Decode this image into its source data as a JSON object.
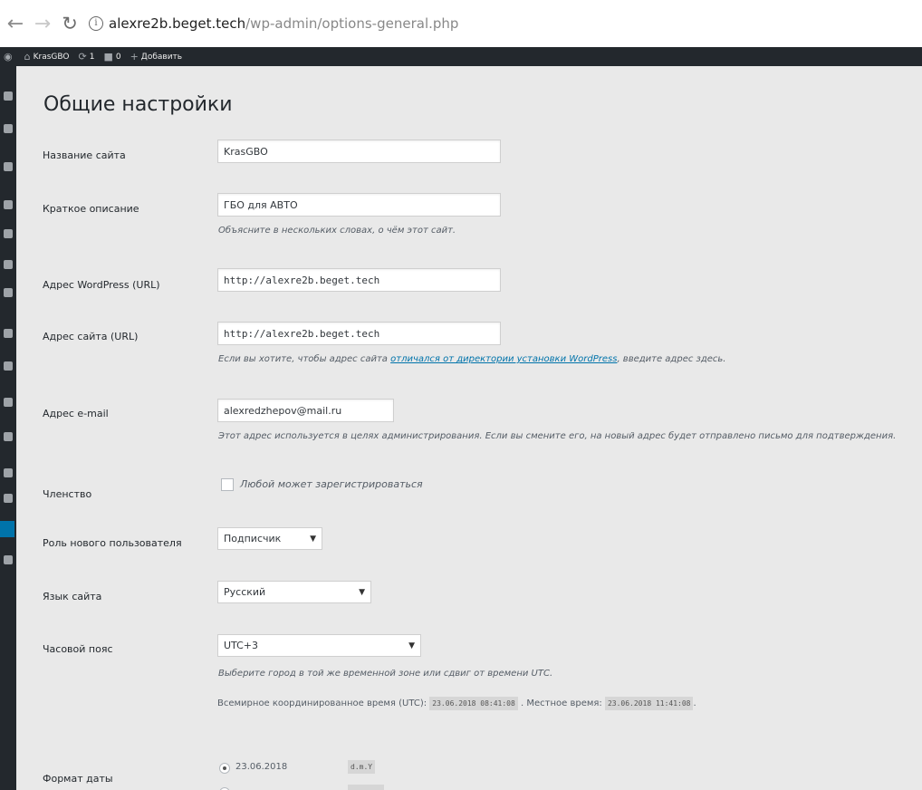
{
  "browser": {
    "back_icon": "back-arrow-icon",
    "forward_icon": "forward-arrow-icon",
    "reload_icon": "reload-icon",
    "url_host": "alexre2b.beget.tech",
    "url_path": "/wp-admin/options-general.php"
  },
  "adminbar": {
    "site_name": "KrasGBO",
    "updates_count": "1",
    "comments_count": "0",
    "add_new_label": "Добавить"
  },
  "page": {
    "title": "Общие настройки"
  },
  "settings": {
    "site_title": {
      "label": "Название сайта",
      "value": "KrasGBO"
    },
    "tagline": {
      "label": "Краткое описание",
      "value": "ГБО для АВТО",
      "description": "Объясните в нескольких словах, о чём этот сайт."
    },
    "wp_url": {
      "label": "Адрес WordPress (URL)",
      "value": "http://alexre2b.beget.tech"
    },
    "site_url": {
      "label": "Адрес сайта (URL)",
      "value": "http://alexre2b.beget.tech",
      "desc_before": "Если вы хотите, чтобы адрес сайта ",
      "desc_link": "отличался от директории установки WordPress",
      "desc_after": ", введите адрес здесь."
    },
    "email": {
      "label": "Адрес e-mail",
      "value": "alexredzhepov@mail.ru",
      "description": "Этот адрес используется в целях администрирования. Если вы смените его, на новый адрес будет отправлено письмо для подтверждения."
    },
    "membership": {
      "label": "Членство",
      "checkbox_label": "Любой может зарегистрироваться",
      "checked": false
    },
    "default_role": {
      "label": "Роль нового пользователя",
      "value": "Подписчик"
    },
    "site_language": {
      "label": "Язык сайта",
      "value": "Русский"
    },
    "timezone": {
      "label": "Часовой пояс",
      "value": "UTC+3",
      "description": "Выберите город в той же временной зоне или сдвиг от времени UTC.",
      "utc_label": "Всемирное координированное время (UTC):",
      "utc_value": "23.06.2018 08:41:08",
      "local_label": ". Местное время:",
      "local_value": "23.06.2018 11:41:08"
    },
    "date_format": {
      "label": "Формат даты",
      "options": [
        {
          "value": "23.06.2018",
          "code": "d.m.Y",
          "selected": true
        }
      ]
    }
  }
}
